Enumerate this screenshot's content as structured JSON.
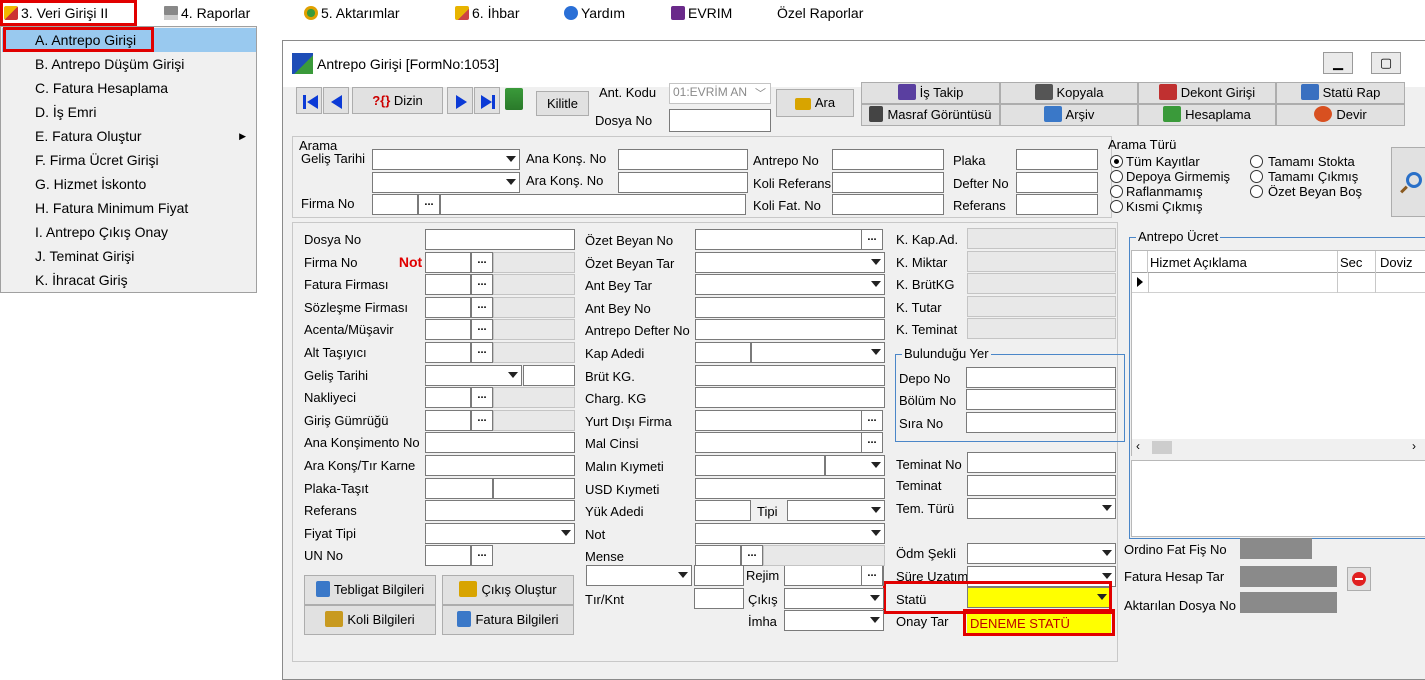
{
  "menubar": {
    "items": [
      {
        "label": "3.  Veri Girişi  II",
        "icon": "edit-icon"
      },
      {
        "label": "4.  Raporlar",
        "icon": "printer-icon"
      },
      {
        "label": "5.  Aktarımlar",
        "icon": "transfer-icon"
      },
      {
        "label": "6. İhbar",
        "icon": "notice-icon"
      },
      {
        "label": "Yardım",
        "icon": "help-icon"
      },
      {
        "label": "EVRIM",
        "icon": "book-icon"
      },
      {
        "label": "Özel Raporlar"
      }
    ]
  },
  "dropdown": {
    "items": [
      "A.  Antrepo Girişi",
      "B.  Antrepo Düşüm Girişi",
      "C. Fatura Hesaplama",
      "D. İş Emri",
      "E. Fatura Oluştur",
      "F. Firma Ücret Girişi",
      "G. Hizmet İskonto",
      "H. Fatura Minimum Fiyat",
      "I. Antrepo Çıkış Onay",
      "J. Teminat Girişi",
      "K. İhracat Giriş"
    ],
    "submenu_arrow": "▶"
  },
  "window": {
    "title": "Antrepo Girişi [FormNo:1053]",
    "min": "—",
    "max": "☐"
  },
  "toolbar": {
    "dizin": "Dizin",
    "dizin_prefix": "?{}",
    "kilitle": "Kilitle",
    "ant_kodu_label": "Ant. Kodu",
    "ant_kodu_value": "01:EVRİM AN",
    "dosya_no_label": "Dosya No",
    "ara": "Ara"
  },
  "actions": {
    "is_takip": "İş Takip",
    "kopyala": "Kopyala",
    "dekont": "Dekont Girişi",
    "statu_rap": "Statü Rap",
    "masraf": "Masraf Görüntüsü",
    "arsiv": "Arşiv",
    "hesaplama": "Hesaplama",
    "devir": "Devir"
  },
  "search": {
    "title": "Arama",
    "gelis_tarihi": "Geliş Tarihi",
    "firma_no": "Firma No",
    "ana_kons": "Ana Konş. No",
    "ara_kons": "Ara Konş. No",
    "antrepo_no": "Antrepo No",
    "koli_ref": "Koli Referans",
    "koli_fat": "Koli Fat. No",
    "plaka": "Plaka",
    "defter_no": "Defter No",
    "referans": "Referans",
    "dots": "..."
  },
  "arama_turu": {
    "title": "Arama Türü",
    "options": [
      "Tüm Kayıtlar",
      "Depoya Girmemiş",
      "Raflanmamış",
      "Kısmi Çıkmış",
      "Tamamı Stokta",
      "Tamamı Çıkmış",
      "Özet Beyan Boş"
    ],
    "selected": "Tüm Kayıtlar"
  },
  "form1": {
    "labels": [
      "Dosya No",
      "Firma No",
      "Fatura Firması",
      "Sözleşme Firması",
      "Acenta/Müşavir",
      "Alt Taşıyıcı",
      "Geliş Tarihi",
      "Nakliyeci",
      "Giriş Gümrüğü",
      "Ana Konşimento No",
      "Ara Konş/Tır Karne",
      "Plaka-Taşıt",
      "Referans",
      "Fiyat Tipi",
      "UN No"
    ],
    "not_text": "Not"
  },
  "form2": {
    "labels": [
      "Özet Beyan No",
      "Özet Beyan Tar",
      "Ant Bey Tar",
      "Ant Bey No",
      "Antrepo Defter No",
      "Kap Adedi",
      "Brüt KG.",
      "Charg. KG",
      "Yurt Dışı Firma",
      "Mal Cinsi",
      "Malın Kıymeti",
      "USD Kıymeti",
      "Yük Adedi",
      "Not",
      "Mense"
    ],
    "tipi": "Tipi",
    "rejim": "Rejim",
    "tir_knt": "Tır/Knt",
    "cikis": "Çıkış",
    "imha": "İmha"
  },
  "form3": {
    "labels": [
      "K. Kap.Ad.",
      "K. Miktar",
      "K. BrütKG",
      "K. Tutar",
      "K. Teminat"
    ],
    "bulundugu_yer": "Bulunduğu Yer",
    "yer_labels": [
      "Depo No",
      "Bölüm No",
      "Sıra No"
    ],
    "teminat_no": "Teminat No",
    "teminat": "Teminat",
    "tem_turu": "Tem. Türü",
    "odm_sekli": "Ödm Şekli",
    "sure_uzatim": "Süre Uzatım",
    "statu": "Statü",
    "onay_tar": "Onay Tar",
    "onay_value": "DENEME STATÜ"
  },
  "bottom_buttons": {
    "tebligat": "Tebligat Bilgileri",
    "cikis_olustur": "Çıkış Oluştur",
    "koli": "Koli Bilgileri",
    "fatura": "Fatura Bilgileri"
  },
  "antrepo_ucret": {
    "title": "Antrepo Ücret",
    "columns": [
      "Hizmet Açıklama",
      "Sec",
      "Doviz"
    ]
  },
  "right_fields": {
    "ordino": "Ordino Fat Fiş No",
    "fatura_hesap": "Fatura Hesap Tar",
    "aktarilan": "Aktarılan Dosya No"
  },
  "colors": {
    "highlight_red": "#e10000",
    "selection_blue": "#99c9ef",
    "statu_yellow": "#ffff00",
    "not_red": "#e00000"
  }
}
